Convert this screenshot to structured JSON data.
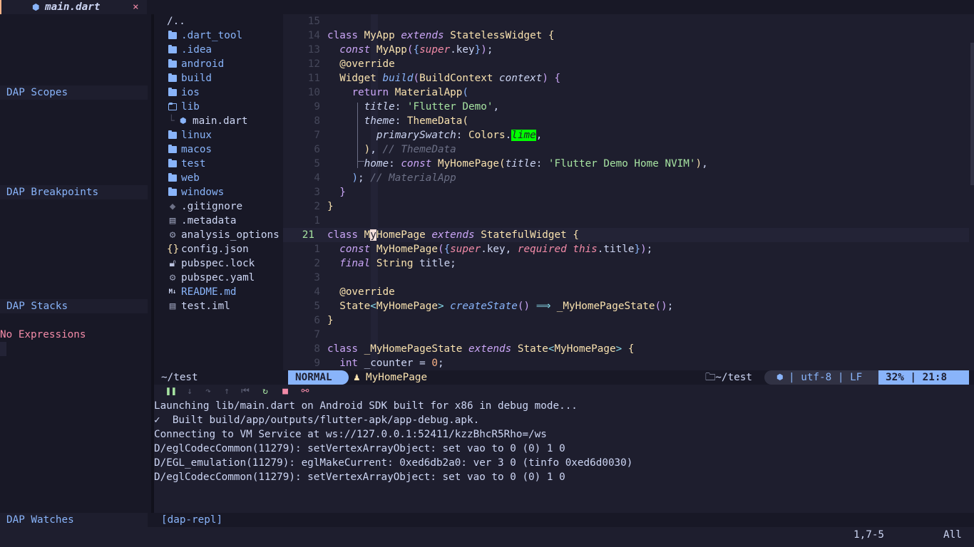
{
  "tab": {
    "filename": "main.dart",
    "close_glyph": "×"
  },
  "dap": {
    "scopes": "DAP Scopes",
    "breakpoints": "DAP Breakpoints",
    "stacks": "DAP Stacks",
    "no_expressions": "No Expressions",
    "watches": "DAP Watches"
  },
  "tree": {
    "root": "/..",
    "items": [
      {
        "label": ".dart_tool",
        "kind": "folder"
      },
      {
        "label": ".idea",
        "kind": "folder"
      },
      {
        "label": "android",
        "kind": "folder"
      },
      {
        "label": "build",
        "kind": "folder"
      },
      {
        "label": "ios",
        "kind": "folder"
      },
      {
        "label": "lib",
        "kind": "folder-open"
      },
      {
        "label": "main.dart",
        "kind": "dart-file"
      },
      {
        "label": "linux",
        "kind": "folder"
      },
      {
        "label": "macos",
        "kind": "folder"
      },
      {
        "label": "test",
        "kind": "folder"
      },
      {
        "label": "web",
        "kind": "folder"
      },
      {
        "label": "windows",
        "kind": "folder"
      },
      {
        "label": ".gitignore",
        "kind": "git-icon"
      },
      {
        "label": ".metadata",
        "kind": "file-icon"
      },
      {
        "label": "analysis_options",
        "kind": "gear-icon"
      },
      {
        "label": "config.json",
        "kind": "json-icon"
      },
      {
        "label": "pubspec.lock",
        "kind": "lock-icon"
      },
      {
        "label": "pubspec.yaml",
        "kind": "gear-icon"
      },
      {
        "label": "README.md",
        "kind": "markdown-icon"
      },
      {
        "label": "test.iml",
        "kind": "file-icon"
      }
    ]
  },
  "editor": {
    "line_numbers": [
      "15",
      "14",
      "13",
      "12",
      "11",
      "10",
      "9",
      "8",
      "7",
      "6",
      "5",
      "4",
      "3",
      "2",
      "1",
      "21",
      "1",
      "2",
      "3",
      "4",
      "5",
      "6",
      "7",
      "8",
      "9"
    ],
    "current_line_index": 15,
    "comment_theme_data": "// ThemeData",
    "comment_material_app": "// MaterialApp",
    "str_flutter_demo": "'Flutter Demo'",
    "str_home": "'Flutter Demo Home NVIM'"
  },
  "status": {
    "cwd": "~/test",
    "mode": "NORMAL",
    "symbol": "MyHomePage",
    "right_cwd": "~/test",
    "encoding": "utf-8 | LF",
    "position": "32% |  21:8"
  },
  "repl": {
    "lines": [
      "Launching lib/main.dart on Android SDK built for x86 in debug mode...",
      "✓  Built build/app/outputs/flutter-apk/app-debug.apk.",
      "Connecting to VM Service at ws://127.0.0.1:52411/kzzBhcR5Rho=/ws",
      "D/eglCodecCommon(11279): setVertexArrayObject: set vao to 0 (0) 1 0",
      "D/EGL_emulation(11279): eglMakeCurrent: 0xed6db2a0: ver 3 0 (tinfo 0xed6d0030)",
      "D/eglCodecCommon(11279): setVertexArrayObject: set vao to 0 (0) 1 0"
    ],
    "bar_label": "[dap-repl]"
  },
  "cmdline": {
    "position": "1,7-5",
    "scroll": "All"
  },
  "colors": {
    "accent": "#89b4fa",
    "background": "#1e1e2e",
    "lime_highlight": "#00ff00",
    "error": "#f38ba8"
  }
}
